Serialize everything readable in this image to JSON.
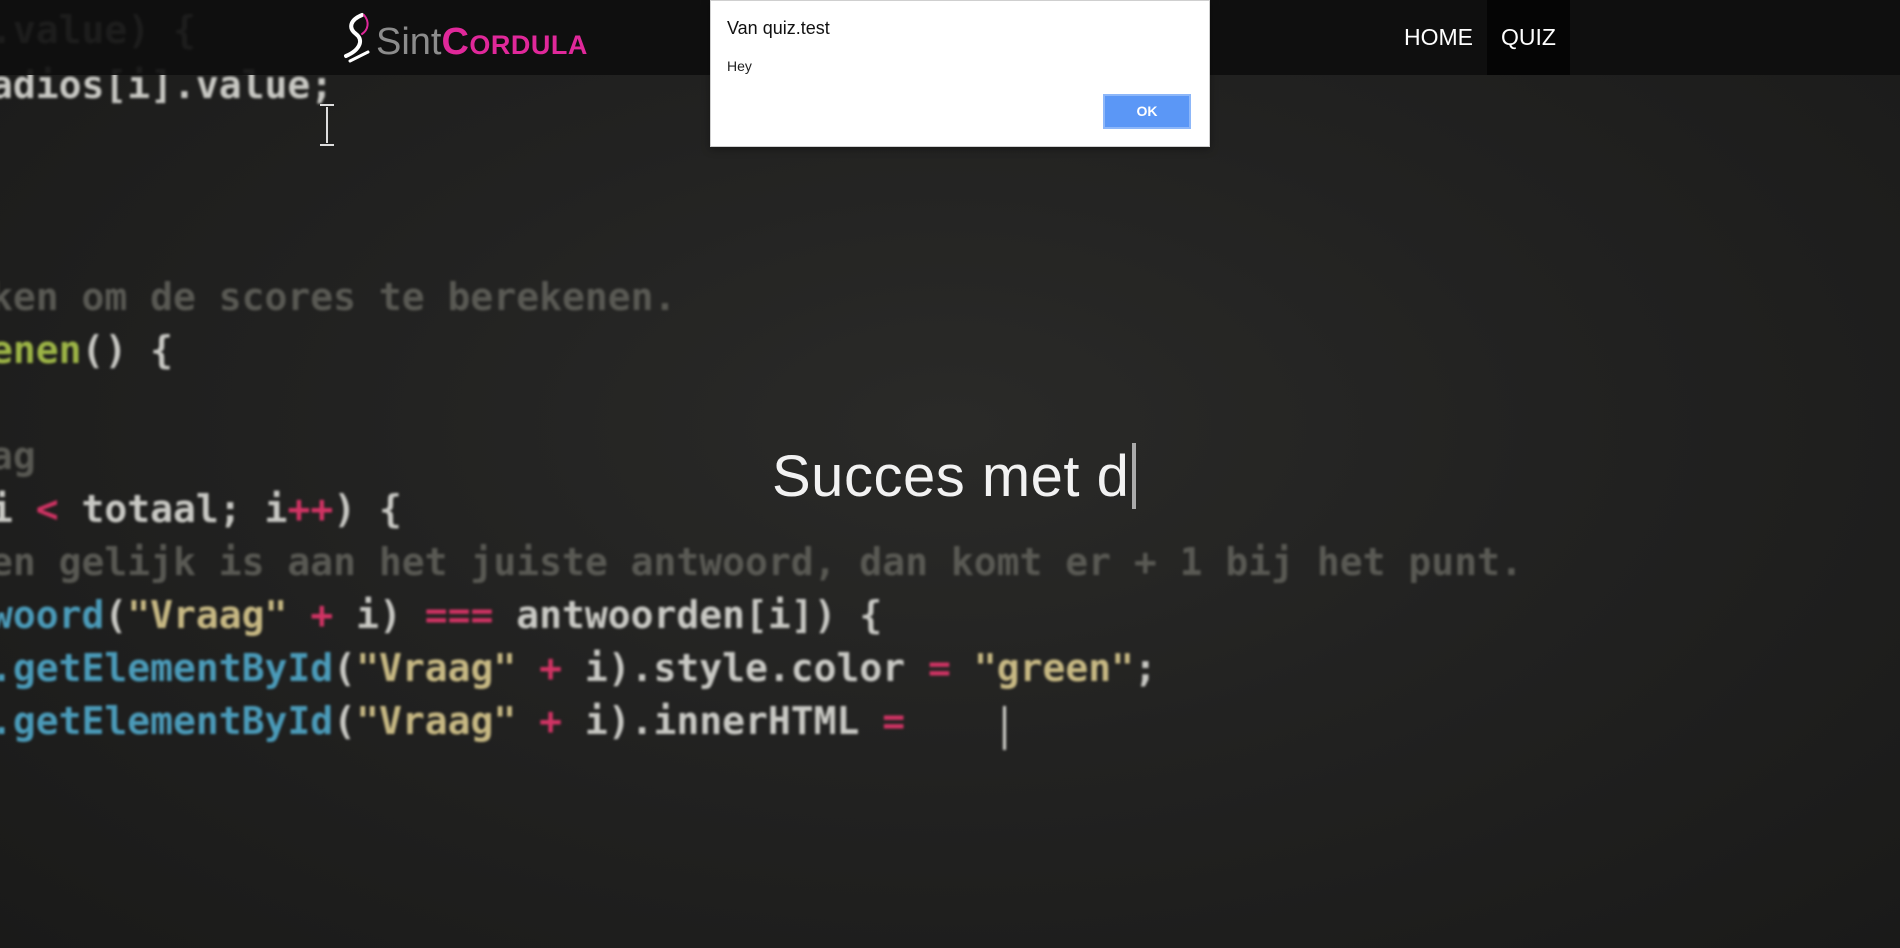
{
  "background_code": [
    [
      {
        "t": ".value) {",
        "c": "c-white"
      }
    ],
    [
      {
        "t": "adios[i].value;",
        "c": "c-white"
      }
    ],
    [
      {
        "t": "ken om de scores te berekenen.",
        "c": "c-comment"
      }
    ],
    [
      {
        "t": "enen",
        "c": "c-fn"
      },
      {
        "t": "() {",
        "c": "c-white"
      }
    ],
    [
      {
        "t": "ag",
        "c": "c-comment"
      }
    ],
    [
      {
        "t": "i ",
        "c": "c-white"
      },
      {
        "t": "<",
        "c": "c-op"
      },
      {
        "t": " totaal; i",
        "c": "c-white"
      },
      {
        "t": "++",
        "c": "c-op"
      },
      {
        "t": ") {",
        "c": "c-white"
      }
    ],
    [
      {
        "t": "en gelijk is aan het juiste antwoord, dan komt er + 1 bij het punt.",
        "c": "c-comment"
      }
    ],
    [
      {
        "t": "woord",
        "c": "c-blue"
      },
      {
        "t": "(",
        "c": "c-white"
      },
      {
        "t": "\"Vraag\"",
        "c": "c-str"
      },
      {
        "t": " + ",
        "c": "c-op"
      },
      {
        "t": "i) ",
        "c": "c-white"
      },
      {
        "t": "===",
        "c": "c-op"
      },
      {
        "t": " antwoorden[i]) {",
        "c": "c-white"
      }
    ],
    [
      {
        "t": ".getElementById",
        "c": "c-blue"
      },
      {
        "t": "(",
        "c": "c-white"
      },
      {
        "t": "\"Vraag\"",
        "c": "c-str"
      },
      {
        "t": " + ",
        "c": "c-op"
      },
      {
        "t": "i).style.color ",
        "c": "c-white"
      },
      {
        "t": "=",
        "c": "c-op"
      },
      {
        "t": " ",
        "c": "c-white"
      },
      {
        "t": "\"green\"",
        "c": "c-str"
      },
      {
        "t": ";",
        "c": "c-white"
      }
    ],
    [
      {
        "t": ".getElementById",
        "c": "c-blue"
      },
      {
        "t": "(",
        "c": "c-white"
      },
      {
        "t": "\"Vraag\"",
        "c": "c-str"
      },
      {
        "t": " + ",
        "c": "c-op"
      },
      {
        "t": "i).innerHTML ",
        "c": "c-white"
      },
      {
        "t": "=",
        "c": "c-op"
      }
    ]
  ],
  "header": {
    "logo_sint": "Sint",
    "logo_cordula": "Cordula",
    "nav": [
      {
        "label": "HOME",
        "active": false
      },
      {
        "label": "QUIZ",
        "active": true
      }
    ]
  },
  "hero": {
    "typing_text": "Succes met d"
  },
  "dialog": {
    "title": "Van quiz.test",
    "message": "Hey",
    "ok_label": "OK"
  }
}
